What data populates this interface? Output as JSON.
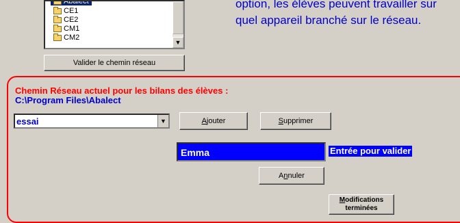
{
  "directory_list": {
    "items": [
      {
        "label": "Abalect",
        "selected": true
      },
      {
        "label": "CE1",
        "selected": false
      },
      {
        "label": "CE2",
        "selected": false
      },
      {
        "label": "CM1",
        "selected": false
      },
      {
        "label": "CM2",
        "selected": false
      }
    ],
    "validate_button": "Valider le chemin réseau"
  },
  "info_text": {
    "line1": "option, les élèves peuvent travailler sur",
    "line2": "quel appareil branché sur le réseau."
  },
  "network_path": {
    "label": "Chemin Réseau actuel pour les bilans des élèves :",
    "path": "C:\\Program Files\\Abalect"
  },
  "group_combo": {
    "selected_value": "essai"
  },
  "buttons": {
    "add": {
      "prefix": "",
      "mnemonic": "A",
      "suffix": "jouter"
    },
    "delete": {
      "prefix": "",
      "mnemonic": "S",
      "suffix": "upprimer"
    },
    "cancel": {
      "prefix": "A",
      "mnemonic": "n",
      "suffix": "nuler"
    },
    "done": {
      "mnemonic": "M",
      "line1_suffix": "odifications",
      "line2": "terminées"
    }
  },
  "name_input": {
    "value": "Emma"
  },
  "enter_hint": "Entrée pour valider",
  "colors": {
    "background": "#d4d0c8",
    "frame_red": "#ff0000",
    "text_blue": "#0000cc",
    "input_blue": "#0000ff"
  }
}
